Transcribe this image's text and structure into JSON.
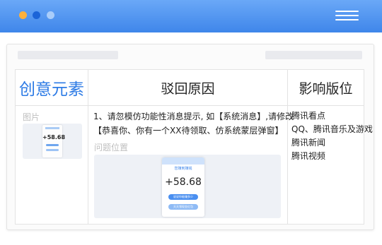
{
  "window": {
    "dots": [
      "#ffb13d",
      "#1b64d8",
      "#a9cdfa"
    ],
    "accent": "#3f86ea"
  },
  "table": {
    "headers": [
      "创意元素",
      "驳回原因",
      "影响版位"
    ],
    "image_label": "图片",
    "thumbnail_value": "+58.68",
    "reason_lines": [
      "1、请忽模仿功能性消息提示, 如【系统消息】,请修改",
      "【恭喜你、你有一个XX待领取、仿系统蒙层弹窗】"
    ],
    "problem_label": "问题位置",
    "preview": {
      "top_text": "您赚到赚钱",
      "value": "+58.68",
      "button_1": "说说你能赚多少",
      "button_2": "天天领现金红包"
    },
    "placements": [
      "腾讯看点",
      "QQ、腾讯音乐及游戏",
      "腾讯新闻",
      "腾讯视频"
    ]
  }
}
